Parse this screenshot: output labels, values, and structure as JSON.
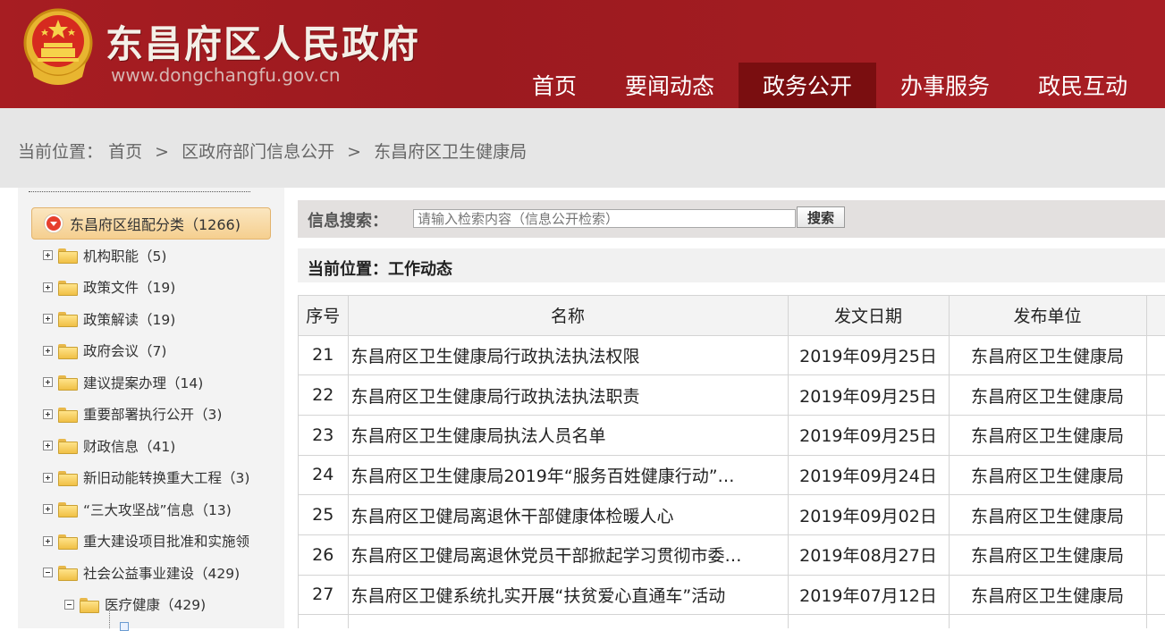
{
  "header": {
    "title": "东昌府区人民政府",
    "url": "www.dongchangfu.gov.cn",
    "brand_color": "#a71d22",
    "nav": [
      {
        "label": "首页",
        "active": false
      },
      {
        "label": "要闻动态",
        "active": false
      },
      {
        "label": "政务公开",
        "active": true
      },
      {
        "label": "办事服务",
        "active": false
      },
      {
        "label": "政民互动",
        "active": false
      }
    ]
  },
  "breadcrumb": {
    "prefix": "当前位置：",
    "items": [
      "首页",
      "区政府部门信息公开",
      "东昌府区卫生健康局"
    ],
    "separator": ">"
  },
  "sidebar": {
    "root": {
      "label": "东昌府区组配分类（1266)",
      "icon": "collapse-circle-icon"
    },
    "items": [
      {
        "label": "机构职能（5)",
        "expander": "plus"
      },
      {
        "label": "政策文件（19)",
        "expander": "plus"
      },
      {
        "label": "政策解读（19)",
        "expander": "plus"
      },
      {
        "label": "政府会议（7)",
        "expander": "plus"
      },
      {
        "label": "建议提案办理（14)",
        "expander": "plus"
      },
      {
        "label": "重要部署执行公开（3)",
        "expander": "plus"
      },
      {
        "label": "财政信息（41)",
        "expander": "plus"
      },
      {
        "label": "新旧动能转换重大工程（3)",
        "expander": "plus"
      },
      {
        "label": "“三大攻坚战”信息（13)",
        "expander": "plus"
      },
      {
        "label": "重大建设项目批准和实施领",
        "expander": "plus"
      },
      {
        "label": "社会公益事业建设（429)",
        "expander": "minus"
      }
    ],
    "child": {
      "label": "医疗健康（429)",
      "expander": "minus"
    }
  },
  "search": {
    "label": "信息搜索：",
    "placeholder": "请输入检索内容（信息公开检索）",
    "button": "搜索"
  },
  "section": {
    "title": "当前位置：工作动态"
  },
  "table": {
    "headers": [
      "序号",
      "名称",
      "发文日期",
      "发布单位"
    ],
    "rows": [
      {
        "no": "21",
        "name": "东昌府区卫生健康局行政执法执法权限",
        "date": "2019年09月25日",
        "unit": "东昌府区卫生健康局"
      },
      {
        "no": "22",
        "name": "东昌府区卫生健康局行政执法执法职责",
        "date": "2019年09月25日",
        "unit": "东昌府区卫生健康局"
      },
      {
        "no": "23",
        "name": "东昌府区卫生健康局执法人员名单",
        "date": "2019年09月25日",
        "unit": "东昌府区卫生健康局"
      },
      {
        "no": "24",
        "name": "东昌府区卫生健康局2019年“服务百姓健康行动”…",
        "date": "2019年09月24日",
        "unit": "东昌府区卫生健康局"
      },
      {
        "no": "25",
        "name": "东昌府区卫健局离退休干部健康体检暖人心",
        "date": "2019年09月02日",
        "unit": "东昌府区卫生健康局"
      },
      {
        "no": "26",
        "name": "东昌府区卫健局离退休党员干部掀起学习贯彻市委…",
        "date": "2019年08月27日",
        "unit": "东昌府区卫生健康局"
      },
      {
        "no": "27",
        "name": "东昌府区卫健系统扎实开展“扶贫爱心直通车”活动",
        "date": "2019年07月12日",
        "unit": "东昌府区卫生健康局"
      }
    ]
  }
}
